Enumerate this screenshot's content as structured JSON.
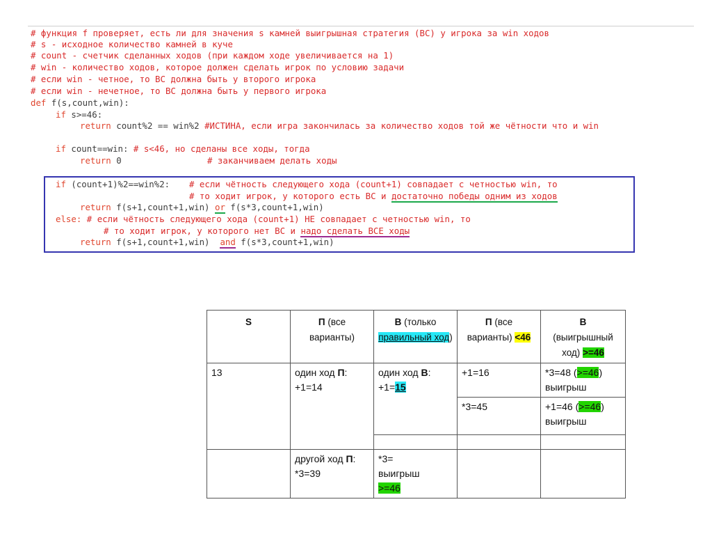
{
  "code": {
    "lines": [
      "# функция f проверяет, есть ли для значения s камней выигрышная стратегия (ВС) у игрока за win ходов",
      "# s - исходное количество камней в куче",
      "# count - счетчик сделанных ходов (при каждом ходе увеличивается на 1)",
      "# win - количество ходов, которое должен сделать игрок по условию задачи",
      "# если win - четное, то ВС должна быть у второго игрока",
      "# если win - нечетное, то ВС должна быть у первого игрока",
      "f(s,count,win):",
      "s>=46:",
      "count%2 == win%2",
      "#ИСТИНА, если игра закончилась за количество ходов той же чётности что и win",
      "count==win:",
      "# s<46, но сделаны все ходы, тогда",
      "0",
      "# заканчиваем делать ходы",
      "(count+1)%2==win%2:",
      "# если чётность следующего хода (count+1) совпадает с четностью win, то",
      "# то ходит игрок, у которого есть ВС и ",
      "достаточно победы одним из ходов",
      "f(s+1,count+1,win)",
      "f(s*3,count+1,win)",
      "# если чётность следующего хода (count+1) НЕ совпадает с четностью win, то",
      "# то ходит игрок, у которого нет ВС и ",
      "надо сделать ВСЕ ходы",
      "f(s+1,count+1,win)",
      "f(s*3,count+1,win)"
    ],
    "keywords": {
      "def": "def",
      "if": "if",
      "return": "return",
      "or": "or",
      "and": "and",
      "else": "else:"
    }
  },
  "table": {
    "headers": [
      {
        "bold": "S",
        "normal": ""
      },
      {
        "bold": "П",
        "normal": " (все варианты)"
      },
      {
        "bold": "В",
        "normal": " (только ",
        "highlight": "правильный ход",
        "tail": ")"
      },
      {
        "bold": "П",
        "normal": " (все варианты) ",
        "highlight": "<46"
      },
      {
        "bold": "В",
        "normal": "(выигрышный ход) ",
        "highlight": ">=46"
      }
    ],
    "s_value": "13",
    "p_move1": {
      "prefix": "один ход ",
      "bold": "П",
      "suffix": ":",
      "expr": "+1=14"
    },
    "v_move1": {
      "prefix": "один ход ",
      "bold": "В",
      "suffix": ":",
      "expr_prefix": "+1=",
      "expr_highlight": "15"
    },
    "p_opt1": "+1=16",
    "p_opt2": "*3=45",
    "v_opt1": {
      "expr": "*3=48 ",
      "paren_open": "(",
      "highlight": ">=46",
      "paren_close": ")",
      "result": "выигрыш"
    },
    "v_opt2": {
      "expr": "+1=46 ",
      "paren_open": "(",
      "highlight": ">=46",
      "paren_close": ")",
      "result": "выигрыш"
    },
    "p_move2": {
      "prefix": "другой ход ",
      "bold": "П",
      "suffix": ":",
      "expr": "*3=39"
    },
    "v_move2": {
      "line1": "*3=",
      "line2": "выигрыш",
      "highlight": ">=46"
    }
  }
}
